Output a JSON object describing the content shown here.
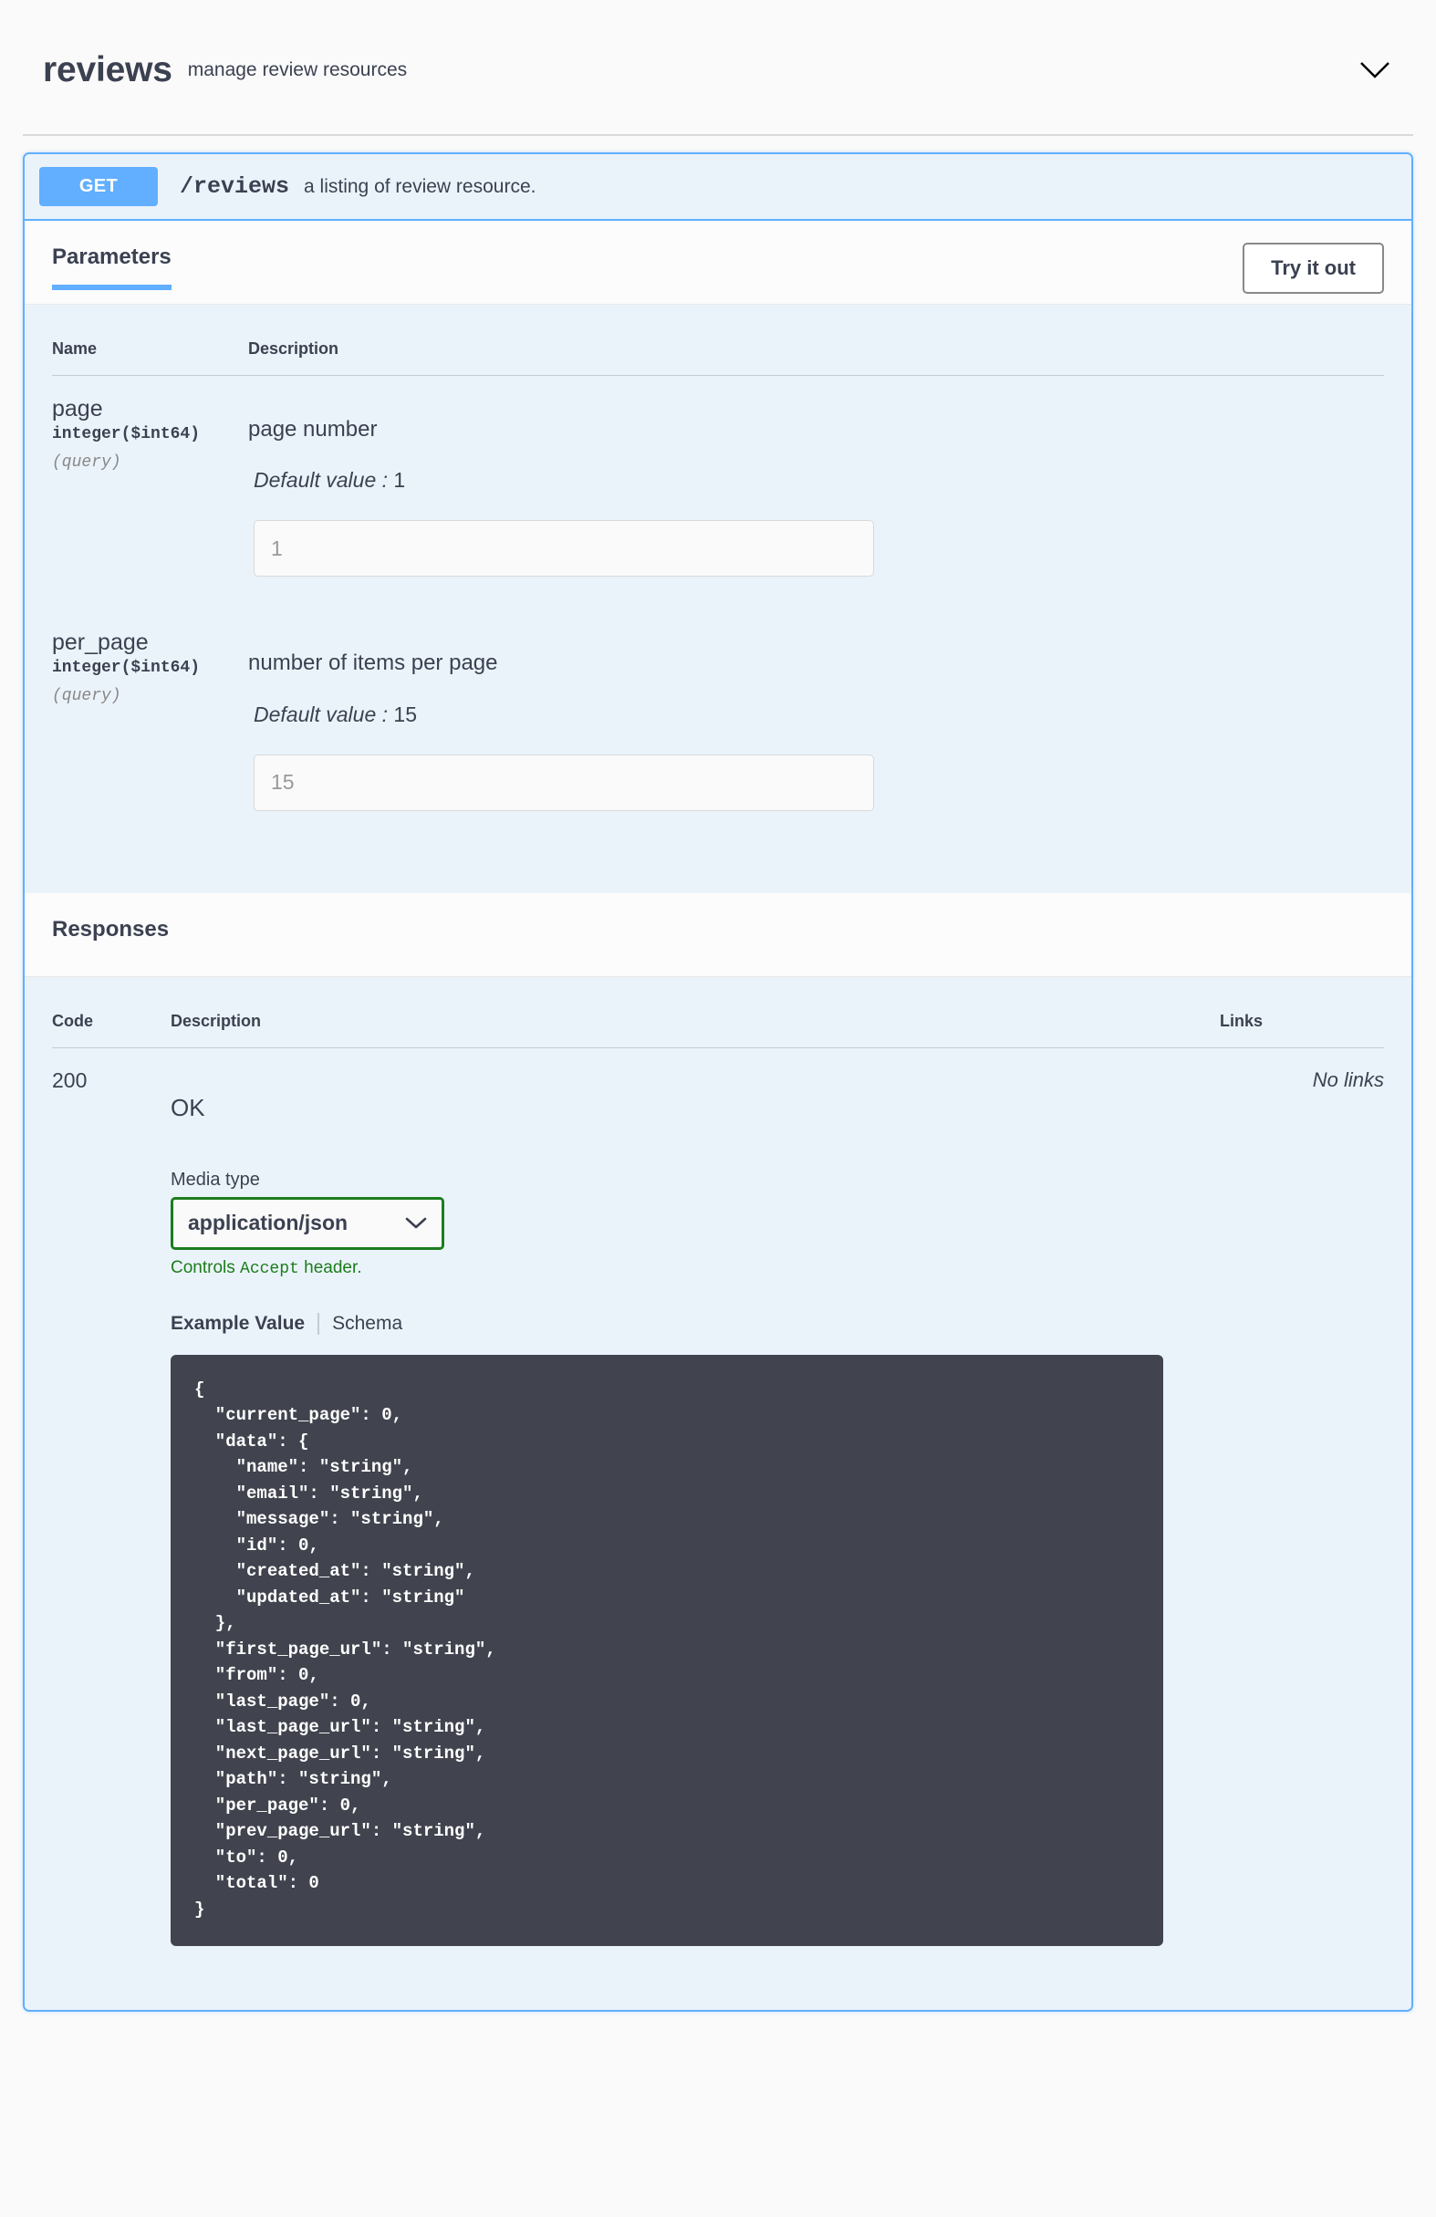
{
  "tag": {
    "title": "reviews",
    "description": "manage review resources",
    "collapse_icon": "chevron-down-icon"
  },
  "operation": {
    "method": "GET",
    "path": "/reviews",
    "summary": "a listing of review resource.",
    "accent_color": "#61affe"
  },
  "parameters_section": {
    "tab_label": "Parameters",
    "try_it_out_label": "Try it out",
    "columns": {
      "name": "Name",
      "description": "Description"
    },
    "items": [
      {
        "name": "page",
        "type": "integer($int64)",
        "in": "(query)",
        "description": "page number",
        "default_label": "Default value",
        "default_value": "1",
        "input_placeholder": "1",
        "input_value": ""
      },
      {
        "name": "per_page",
        "type": "integer($int64)",
        "in": "(query)",
        "description": "number of items per page",
        "default_label": "Default value",
        "default_value": "15",
        "input_placeholder": "15",
        "input_value": ""
      }
    ]
  },
  "responses_section": {
    "title": "Responses",
    "columns": {
      "code": "Code",
      "description": "Description",
      "links": "Links"
    },
    "rows": [
      {
        "code": "200",
        "description": "OK",
        "links": "No links",
        "media_type_label": "Media type",
        "media_type_value": "application/json",
        "media_type_chevron": "chevron-down-icon",
        "media_hint_prefix": "Controls ",
        "media_hint_mono": "Accept",
        "media_hint_suffix": " header.",
        "media_hint_color": "#1c7d1c",
        "example_tab": "Example Value",
        "schema_tab": "Schema",
        "example_value": "{\n  \"current_page\": 0,\n  \"data\": {\n    \"name\": \"string\",\n    \"email\": \"string\",\n    \"message\": \"string\",\n    \"id\": 0,\n    \"created_at\": \"string\",\n    \"updated_at\": \"string\"\n  },\n  \"first_page_url\": \"string\",\n  \"from\": 0,\n  \"last_page\": 0,\n  \"last_page_url\": \"string\",\n  \"next_page_url\": \"string\",\n  \"path\": \"string\",\n  \"per_page\": 0,\n  \"prev_page_url\": \"string\",\n  \"to\": 0,\n  \"total\": 0\n}"
      }
    ]
  }
}
